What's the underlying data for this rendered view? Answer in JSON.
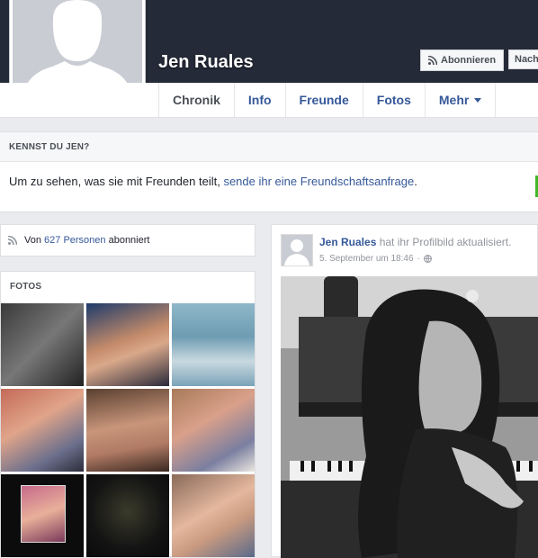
{
  "header": {
    "name": "Jen Ruales",
    "subscribe_label": "Abonnieren",
    "message_label": "Nach"
  },
  "nav": {
    "tabs": [
      {
        "label": "Chronik"
      },
      {
        "label": "Info"
      },
      {
        "label": "Freunde"
      },
      {
        "label": "Fotos"
      },
      {
        "label": "Mehr"
      }
    ]
  },
  "know": {
    "heading": "KENNST DU JEN?",
    "text": "Um zu sehen, was sie mit Freunden teilt, ",
    "link": "sende ihr eine Freundschaftsanfrage",
    "suffix": "."
  },
  "subscribers": {
    "prefix": "Von ",
    "count_link": "627 Personen",
    "suffix": " abonniert"
  },
  "photos": {
    "heading": "FOTOS"
  },
  "post": {
    "author": "Jen Ruales",
    "action": " hat ihr Profilbild aktualisiert.",
    "date": "5. September um 18:46",
    "dot": "·"
  },
  "colors": {
    "cover": "#252a38",
    "link": "#365899",
    "background": "#e9ebee"
  }
}
